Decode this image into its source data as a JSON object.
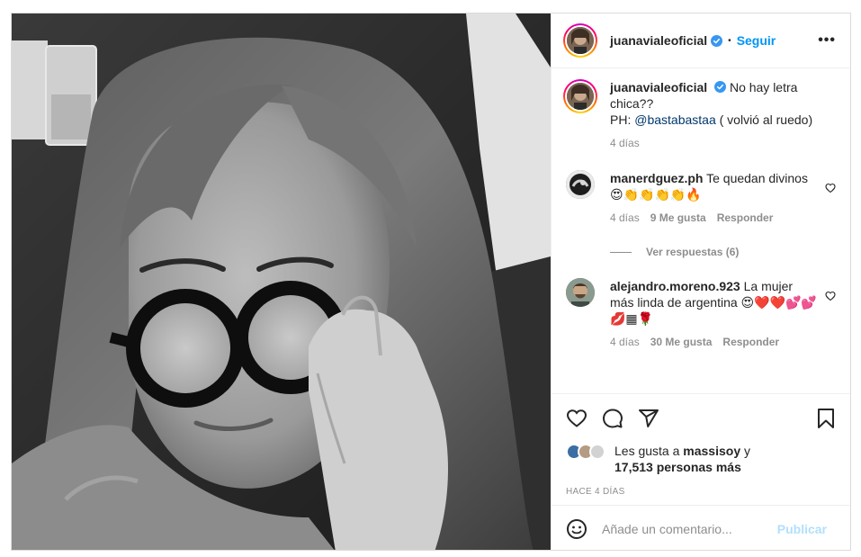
{
  "post": {
    "username": "juanavialeoficial",
    "verified": true,
    "separator": "•",
    "follow_label": "Seguir",
    "more_label": "•••"
  },
  "caption": {
    "username": "juanavialeoficial",
    "text_line1": "No hay letra",
    "text_line2": "chica??",
    "ph_prefix": "PH:",
    "mention": "@bastabastaa",
    "ph_suffix": "( volvió al ruedo)",
    "time": "4 días"
  },
  "comments": [
    {
      "username": "manerdguez.ph",
      "text": "Te quedan divinos 😍👏👏👏👏🔥",
      "time": "4 días",
      "likes": "9 Me gusta",
      "reply_label": "Responder",
      "view_replies": "Ver respuestas (6)"
    },
    {
      "username": "alejandro.moreno.923",
      "text": "La mujer más linda de argentina 😍❤️❤️💕💕💋▦🌹",
      "time": "4 días",
      "likes": "30 Me gusta",
      "reply_label": "Responder"
    }
  ],
  "likes": {
    "prefix": "Les gusta a",
    "user": "massisoy",
    "joiner": "y",
    "others": "17,513 personas más"
  },
  "age": "HACE 4 DÍAS",
  "comment_box": {
    "placeholder": "Añade un comentario...",
    "publish_label": "Publicar"
  },
  "icons": {
    "like": "heart-icon",
    "comment": "comment-icon",
    "share": "share-icon",
    "save": "bookmark-icon",
    "emoji": "emoji-icon",
    "verified": "verified-badge-icon",
    "more": "more-options-icon"
  },
  "colors": {
    "link_blue": "#0095f6",
    "publish_disabled": "#b2dffc",
    "meta_grey": "#8e8e8e",
    "text": "#262626",
    "border": "#dbdbdb"
  }
}
